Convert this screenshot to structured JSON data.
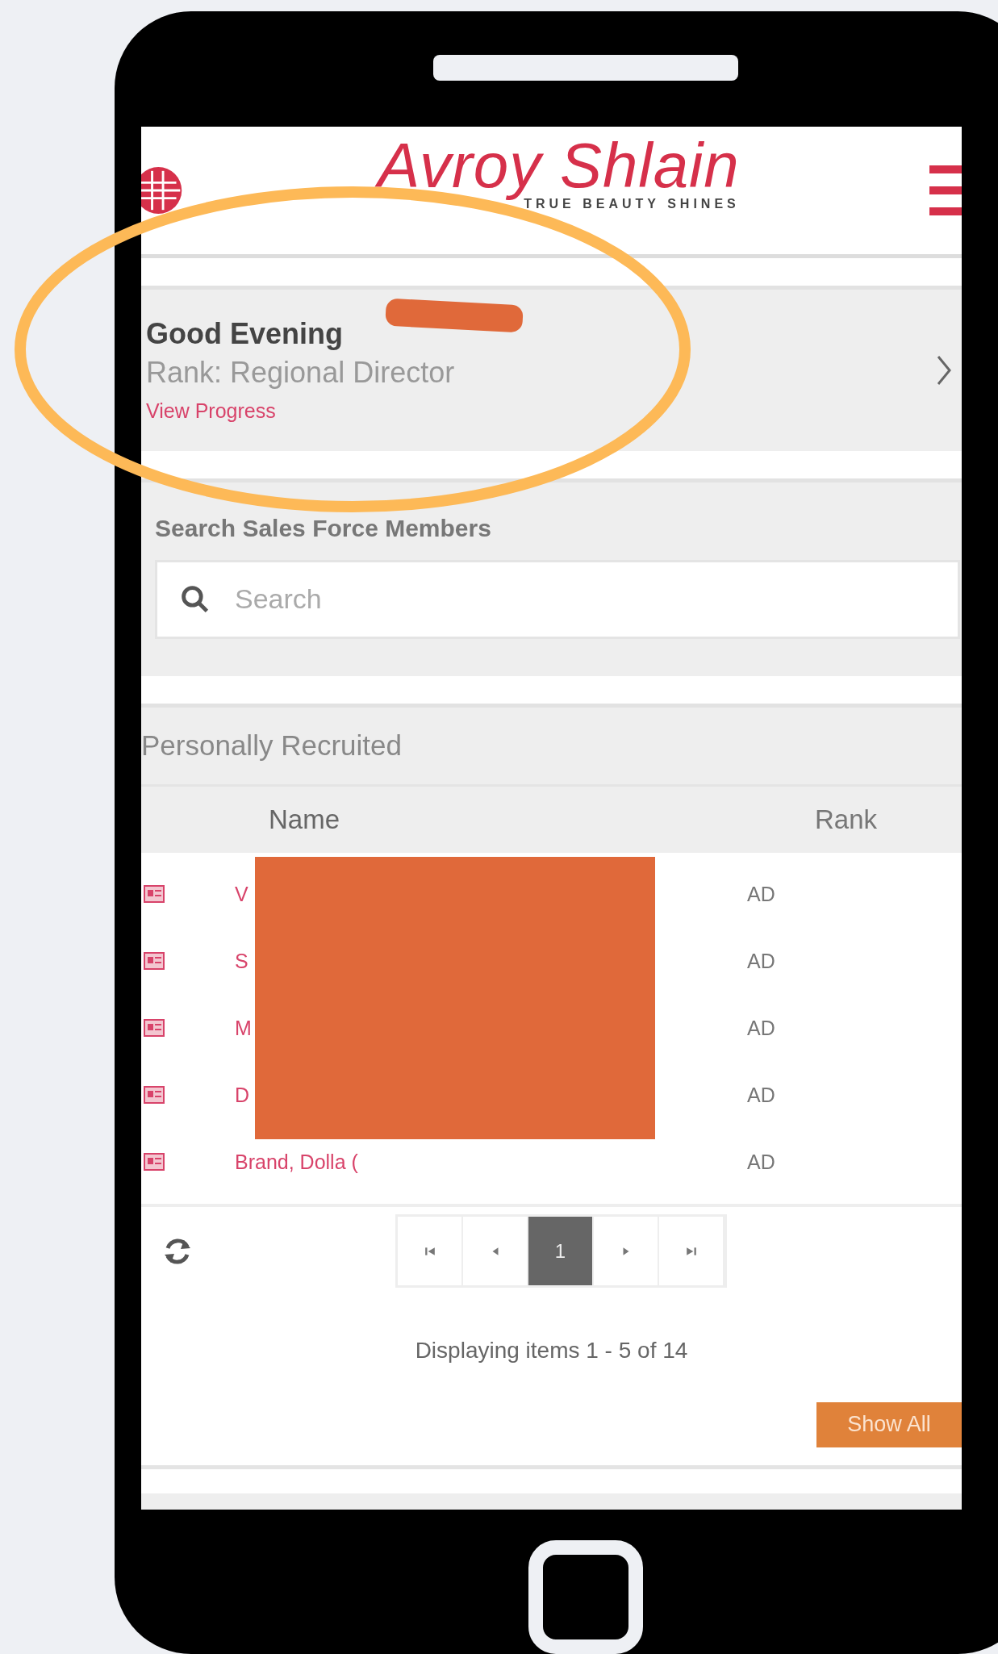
{
  "header": {
    "logo": {
      "name": "Avroy Shlain",
      "tagline": "TRUE BEAUTY SHINES"
    }
  },
  "greeting": {
    "title": "Good Evening",
    "rank": "Rank: Regional Director",
    "link": "View Progress"
  },
  "search": {
    "label": "Search Sales Force Members",
    "placeholder": "Search"
  },
  "recruited": {
    "title": "Personally Recruited",
    "columns": [
      "Name",
      "Rank"
    ],
    "rows": [
      {
        "name": "V",
        "rank": "AD"
      },
      {
        "name": "S",
        "rank": "AD"
      },
      {
        "name": "M",
        "rank": "AD"
      },
      {
        "name": "D",
        "rank": "AD"
      },
      {
        "name": "Brand, Dolla (",
        "rank": "AD"
      }
    ]
  },
  "pager": {
    "pages": [
      {
        "label": "1",
        "selected": true
      }
    ],
    "summary": "Displaying items 1 - 5 of 14"
  },
  "show_all": "Show All"
}
